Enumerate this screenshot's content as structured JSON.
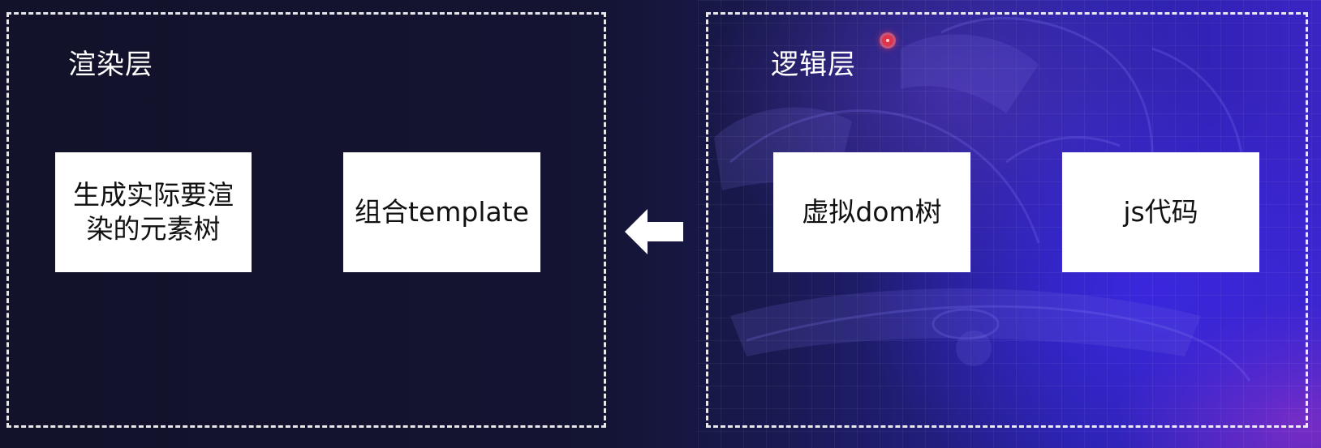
{
  "render_layer": {
    "title": "渲染层",
    "box_render_tree": "生成实际要渲染的元素树",
    "box_template": "组合template"
  },
  "logic_layer": {
    "title": "逻辑层",
    "box_virtual_dom": "虚拟dom树",
    "box_js": "js代码"
  },
  "arrow": {
    "direction": "left",
    "icon": "left-arrow-icon",
    "color": "#ffffff"
  },
  "colors": {
    "background_left": "#12122a",
    "background_right": "#3a24c4",
    "box_fill": "#ffffff",
    "border": "#ffffff",
    "pointer": "#e0344a"
  }
}
